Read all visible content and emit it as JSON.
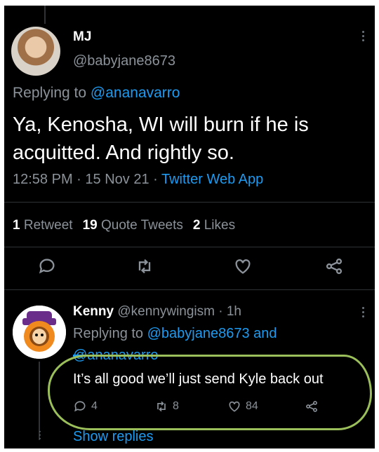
{
  "tweet": {
    "name": "MJ",
    "handle": "@babyjane8673",
    "replying_prefix": "Replying to ",
    "replying_to": "@ananavarro",
    "text": "Ya, Kenosha, WI will burn if he is acquitted. And rightly so.",
    "time": "12:58 PM",
    "dot1": " · ",
    "date": "15 Nov 21",
    "dot2": " · ",
    "source": "Twitter Web App",
    "stats": {
      "retweets_count": "1",
      "retweets_label": "Retweet",
      "quotes_count": "19",
      "quotes_label": "Quote Tweets",
      "likes_count": "2",
      "likes_label": "Likes"
    },
    "actions": [
      "reply-icon",
      "retweet-icon",
      "like-icon",
      "share-icon"
    ]
  },
  "reply": {
    "name": "Kenny",
    "handle": "@kennywingism",
    "age": " · 1h",
    "replying_prefix": "Replying to ",
    "replying_to_1": "@babyjane8673",
    "and": " and",
    "replying_to_2": "@ananavarro",
    "text": "It’s all good we’ll just send Kyle back out",
    "reply_count": "4",
    "retweet_count": "8",
    "like_count": "84",
    "show_replies": "Show replies"
  },
  "colors": {
    "background": "#000000",
    "text": "#ffffff",
    "muted": "#8b9299",
    "link": "#1d9bf0",
    "highlight_circle": "#9bbf5a"
  }
}
